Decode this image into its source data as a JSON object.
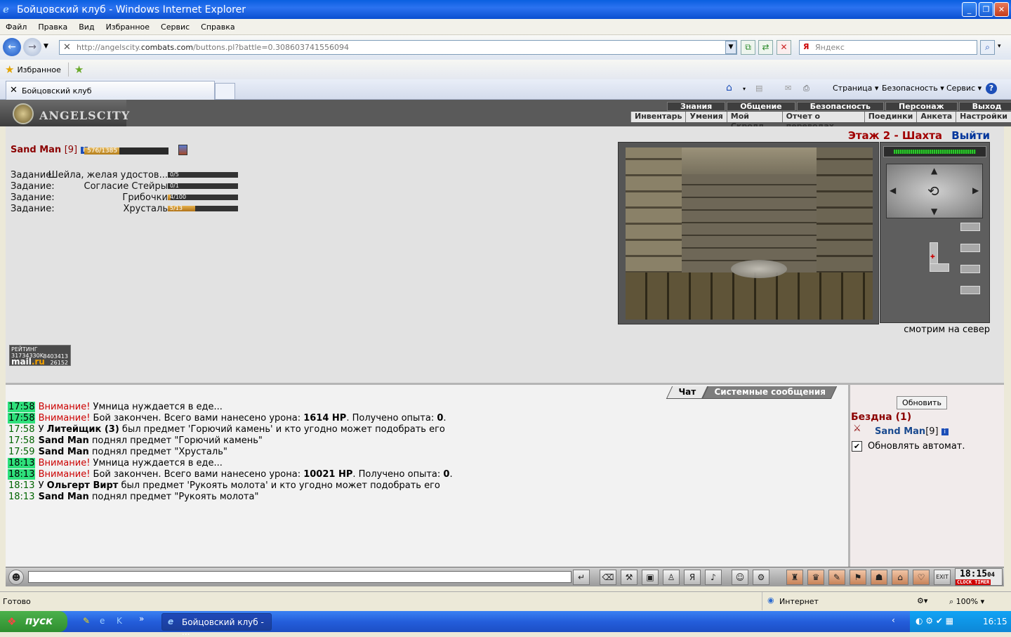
{
  "window": {
    "title": "Бойцовский клуб - Windows Internet Explorer"
  },
  "menu": [
    "Файл",
    "Правка",
    "Вид",
    "Избранное",
    "Сервис",
    "Справка"
  ],
  "address": {
    "prefix": "http://angelscity.",
    "domain": "combats.com",
    "path": "/buttons.pl?battle=0.308603741556094"
  },
  "search": {
    "placeholder": "Яндекс"
  },
  "favorites": {
    "label": "Избранное"
  },
  "tab": {
    "title": "Бойцовский клуб"
  },
  "commands": {
    "page": "Страница ▾",
    "safety": "Безопасность ▾",
    "service": "Сервис ▾"
  },
  "game": {
    "logo": "ANGELSCITY",
    "top_menu": [
      "Знания",
      "Общение",
      "Безопасность",
      "Персонаж",
      "Выход"
    ],
    "sub_menu": [
      "Инвентарь",
      "Умения",
      "Мой Скролл",
      "Отчет о переводах",
      "Поединки",
      "Анкета",
      "Настройки"
    ],
    "character": {
      "name": "Sand Man",
      "level": "[9]",
      "hp": "576/1385",
      "hp_fraction": 0.416
    },
    "quests": [
      {
        "label": "Задание:",
        "name": "Шейла, желая удостов...",
        "progress": "0/5",
        "fraction": 0
      },
      {
        "label": "Задание:",
        "name": "Согласие Стейры",
        "progress": "0/1",
        "fraction": 0
      },
      {
        "label": "Задание:",
        "name": "Грибочки",
        "progress": "4/100",
        "fraction": 0.04
      },
      {
        "label": "Задание:",
        "name": "Хрусталь",
        "progress": "5/13",
        "fraction": 0.385
      }
    ],
    "floor": "Этаж 2 - Шахта",
    "exit": "Выйти",
    "look": "смотрим на север",
    "counter": {
      "line1": "РЕЙТИНГ 31734330K",
      "brand_a": "mail",
      "brand_b": ".ru",
      "n1": "8403413",
      "n2": "26152"
    }
  },
  "chat": {
    "tab_chat": "Чат",
    "tab_system": "Системные сообщения",
    "lines": [
      {
        "time": "17:58",
        "hl": true,
        "warn": "Внимание!",
        "parts": [
          " Умница нуждается в еде..."
        ]
      },
      {
        "time": "17:58",
        "hl": true,
        "warn": "Внимание!",
        "text": " Бой закончен. Всего вами нанесено урона: ",
        "bold": "1614 HP",
        "text2": ". Получено опыта: ",
        "bold2": "0",
        "text3": "."
      },
      {
        "time": "17:58",
        "hl": false,
        "pre": "У ",
        "bold": "Литейщик (3)",
        "text": " был предмет 'Горючий камень' и кто угодно может подобрать его"
      },
      {
        "time": "17:58",
        "hl": false,
        "bold": "Sand Man",
        "text": " поднял предмет \"Горючий камень\""
      },
      {
        "time": "17:59",
        "hl": false,
        "bold": "Sand Man",
        "text": " поднял предмет \"Хрусталь\""
      },
      {
        "time": "18:13",
        "hl": true,
        "warn": "Внимание!",
        "parts": [
          " Умница нуждается в еде..."
        ]
      },
      {
        "time": "18:13",
        "hl": true,
        "warn": "Внимание!",
        "text": " Бой закончен. Всего вами нанесено урона: ",
        "bold": "10021 HP",
        "text2": ". Получено опыта: ",
        "bold2": "0",
        "text3": "."
      },
      {
        "time": "18:13",
        "hl": false,
        "pre": "У ",
        "bold": "Ольгерт Вирт",
        "text": " был предмет 'Рукоять молота' и кто угодно может подобрать его"
      },
      {
        "time": "18:13",
        "hl": false,
        "bold": "Sand Man",
        "text": " поднял предмет \"Рукоять молота\""
      }
    ]
  },
  "room": {
    "refresh": "Обновить",
    "title": "Бездна (1)",
    "user": "Sand Man",
    "level": "[9]",
    "auto": "Обновлять автомат."
  },
  "clock": {
    "time": "18:15",
    "sec": "04",
    "label_a": "CLOCK",
    "label_b": "TIMER"
  },
  "status": {
    "left": "Готово",
    "zone": "Интернет",
    "zoom": "100%"
  },
  "taskbar": {
    "start": "пуск",
    "task": "Бойцовский клуб - ...",
    "time": "16:15"
  },
  "colors": {
    "name": "#8b0000",
    "link": "#1a4a8f",
    "highlight": "#2ee17b",
    "warning": "#cc0000"
  }
}
